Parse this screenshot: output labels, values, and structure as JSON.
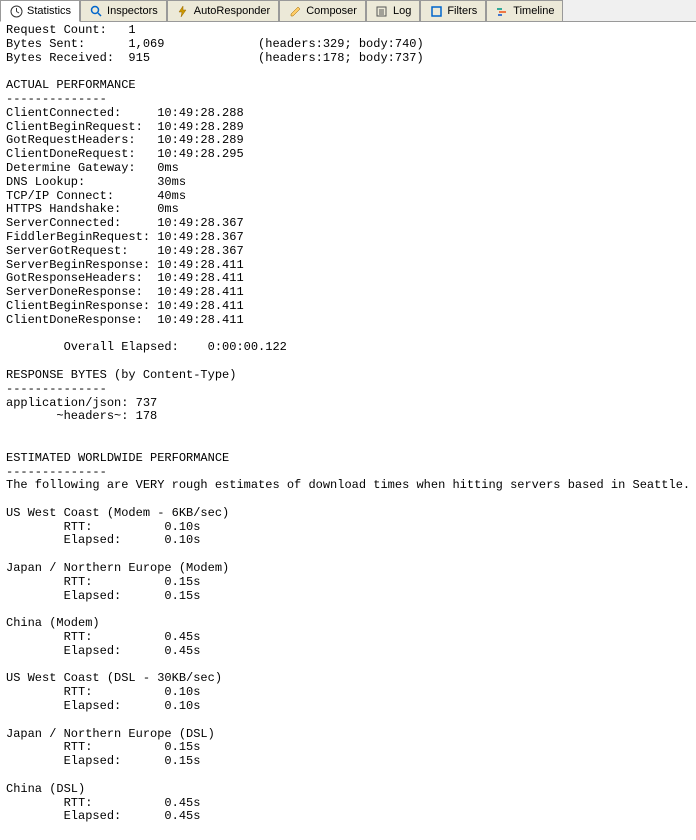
{
  "tabs": {
    "statistics": "Statistics",
    "inspectors": "Inspectors",
    "autoresponder": "AutoResponder",
    "composer": "Composer",
    "log": "Log",
    "filters": "Filters",
    "timeline": "Timeline"
  },
  "summary": {
    "request_count_label": "Request Count:",
    "request_count_value": "1",
    "bytes_sent_label": "Bytes Sent:",
    "bytes_sent_value": "1,069",
    "bytes_sent_detail": "(headers:329; body:740)",
    "bytes_received_label": "Bytes Received:",
    "bytes_received_value": "915",
    "bytes_received_detail": "(headers:178; body:737)"
  },
  "actual_performance": {
    "heading": "ACTUAL PERFORMANCE",
    "sep": "--------------",
    "rows": [
      {
        "k": "ClientConnected:",
        "v": "10:49:28.288"
      },
      {
        "k": "ClientBeginRequest:",
        "v": "10:49:28.289"
      },
      {
        "k": "GotRequestHeaders:",
        "v": "10:49:28.289"
      },
      {
        "k": "ClientDoneRequest:",
        "v": "10:49:28.295"
      },
      {
        "k": "Determine Gateway:",
        "v": "0ms"
      },
      {
        "k": "DNS Lookup:",
        "v": "30ms"
      },
      {
        "k": "TCP/IP Connect:",
        "v": "40ms"
      },
      {
        "k": "HTTPS Handshake:",
        "v": "0ms"
      },
      {
        "k": "ServerConnected:",
        "v": "10:49:28.367"
      },
      {
        "k": "FiddlerBeginRequest:",
        "v": "10:49:28.367"
      },
      {
        "k": "ServerGotRequest:",
        "v": "10:49:28.367"
      },
      {
        "k": "ServerBeginResponse:",
        "v": "10:49:28.411"
      },
      {
        "k": "GotResponseHeaders:",
        "v": "10:49:28.411"
      },
      {
        "k": "ServerDoneResponse:",
        "v": "10:49:28.411"
      },
      {
        "k": "ClientBeginResponse:",
        "v": "10:49:28.411"
      },
      {
        "k": "ClientDoneResponse:",
        "v": "10:49:28.411"
      }
    ],
    "overall_label": "Overall Elapsed:",
    "overall_value": "0:00:00.122"
  },
  "response_bytes": {
    "heading": "RESPONSE BYTES (by Content-Type)",
    "sep": "--------------",
    "rows": [
      {
        "k": "application/json:",
        "v": "737"
      },
      {
        "k": "~headers~:",
        "v": "178"
      }
    ]
  },
  "estimated": {
    "heading": "ESTIMATED WORLDWIDE PERFORMANCE",
    "sep": "--------------",
    "note": "The following are VERY rough estimates of download times when hitting servers based in Seattle.",
    "regions": [
      {
        "name": "US West Coast (Modem - 6KB/sec)",
        "rtt": "0.10s",
        "elapsed": "0.10s"
      },
      {
        "name": "Japan / Northern Europe (Modem)",
        "rtt": "0.15s",
        "elapsed": "0.15s"
      },
      {
        "name": "China (Modem)",
        "rtt": "0.45s",
        "elapsed": "0.45s"
      },
      {
        "name": "US West Coast (DSL - 30KB/sec)",
        "rtt": "0.10s",
        "elapsed": "0.10s"
      },
      {
        "name": "Japan / Northern Europe (DSL)",
        "rtt": "0.15s",
        "elapsed": "0.15s"
      },
      {
        "name": "China (DSL)",
        "rtt": "0.45s",
        "elapsed": "0.45s"
      }
    ],
    "rtt_label": "RTT:",
    "elapsed_label": "Elapsed:"
  }
}
